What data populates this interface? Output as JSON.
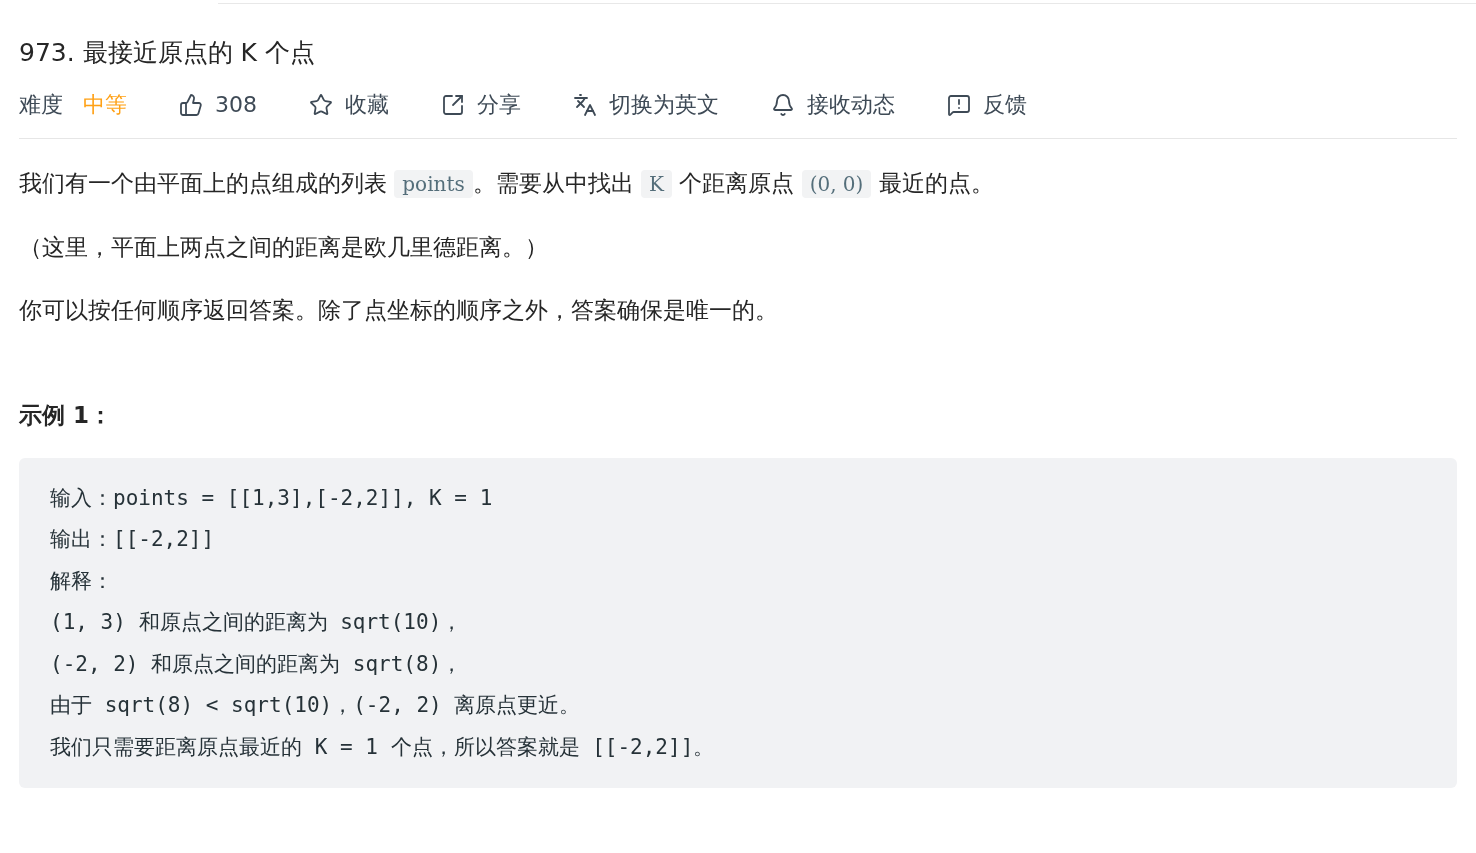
{
  "title": "973. 最接近原点的 K 个点",
  "difficulty": {
    "label": "难度",
    "value": "中等",
    "kind": "medium"
  },
  "actions": [
    {
      "kind": "like",
      "label": "308"
    },
    {
      "kind": "star",
      "label": "收藏"
    },
    {
      "kind": "share",
      "label": "分享"
    },
    {
      "kind": "translate",
      "label": "切换为英文"
    },
    {
      "kind": "bell",
      "label": "接收动态"
    },
    {
      "kind": "feedback",
      "label": "反馈"
    }
  ],
  "paragraphs": [
    [
      {
        "kind": "text",
        "text": "我们有一个由平面上的点组成的列表 "
      },
      {
        "kind": "code",
        "text": "points"
      },
      {
        "kind": "text",
        "text": "。需要从中找出 "
      },
      {
        "kind": "code",
        "text": "K"
      },
      {
        "kind": "text",
        "text": " 个距离原点 "
      },
      {
        "kind": "code",
        "text": "(0, 0)"
      },
      {
        "kind": "text",
        "text": " 最近的点。"
      }
    ],
    [
      {
        "kind": "text",
        "text": "（这里，平面上两点之间的距离是欧几里德距离。）"
      }
    ],
    [
      {
        "kind": "text",
        "text": "你可以按任何顺序返回答案。除了点坐标的顺序之外，答案确保是唯一的。"
      }
    ]
  ],
  "example": {
    "heading": "示例 1：",
    "lines": [
      "输入：points = [[1,3],[-2,2]], K = 1",
      "输出：[[-2,2]]",
      "解释：",
      "(1, 3) 和原点之间的距离为 sqrt(10)，",
      "(-2, 2) 和原点之间的距离为 sqrt(8)，",
      "由于 sqrt(8) < sqrt(10)，(-2, 2) 离原点更近。",
      "我们只需要距离原点最近的 K = 1 个点，所以答案就是 [[-2,2]]。"
    ]
  }
}
